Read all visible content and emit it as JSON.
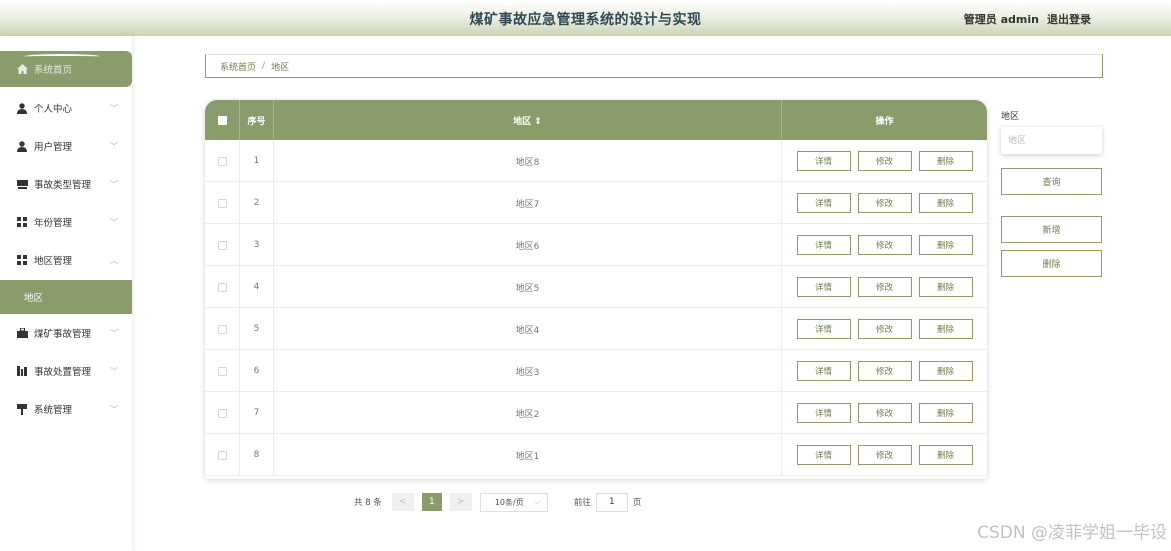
{
  "header": {
    "title": "煤矿事故应急管理系统的设计与实现",
    "user_label": "管理员 admin",
    "logout_label": "退出登录"
  },
  "sidebar": {
    "items": [
      {
        "label": "系统首页",
        "icon": "home-icon"
      },
      {
        "label": "个人中心",
        "icon": "user-icon",
        "chevron": "﹀"
      },
      {
        "label": "用户管理",
        "icon": "user-icon",
        "chevron": "﹀"
      },
      {
        "label": "事故类型管理",
        "icon": "folder-icon",
        "chevron": "﹀"
      },
      {
        "label": "年份管理",
        "icon": "grid-icon",
        "chevron": "﹀"
      },
      {
        "label": "地区管理",
        "icon": "grid-icon",
        "chevron": "︿"
      },
      {
        "label": "地区"
      },
      {
        "label": "煤矿事故管理",
        "icon": "briefcase-icon",
        "chevron": "﹀"
      },
      {
        "label": "事故处置管理",
        "icon": "chart-icon",
        "chevron": "﹀"
      },
      {
        "label": "系统管理",
        "icon": "sign-icon",
        "chevron": "﹀"
      }
    ]
  },
  "breadcrumb": {
    "home": "系统首页",
    "separator": "/",
    "current": "地区"
  },
  "table": {
    "columns": {
      "no": "序号",
      "area": "地区 ⇕",
      "ops": "操作"
    },
    "buttons": {
      "detail": "详情",
      "edit": "修改",
      "delete": "删除"
    },
    "rows": [
      {
        "no": "1",
        "area": "地区8"
      },
      {
        "no": "2",
        "area": "地区7"
      },
      {
        "no": "3",
        "area": "地区6"
      },
      {
        "no": "4",
        "area": "地区5"
      },
      {
        "no": "5",
        "area": "地区4"
      },
      {
        "no": "6",
        "area": "地区3"
      },
      {
        "no": "7",
        "area": "地区2"
      },
      {
        "no": "8",
        "area": "地区1"
      }
    ]
  },
  "search": {
    "label": "地区",
    "placeholder": "地区",
    "query_button": "查询",
    "add_button": "新增",
    "delete_button": "删除"
  },
  "pagination": {
    "total": "共 8 条",
    "prev": "<",
    "current_page": "1",
    "next": ">",
    "page_size": "10条/页",
    "dropdown": "⌵",
    "goto_prefix": "前往",
    "goto_value": "1",
    "goto_suffix": "页"
  },
  "watermark": "CSDN @凌菲学姐一毕设",
  "colors": {
    "accent": "#8a9b6c",
    "header_gradient_end": "#c9d3b6"
  }
}
